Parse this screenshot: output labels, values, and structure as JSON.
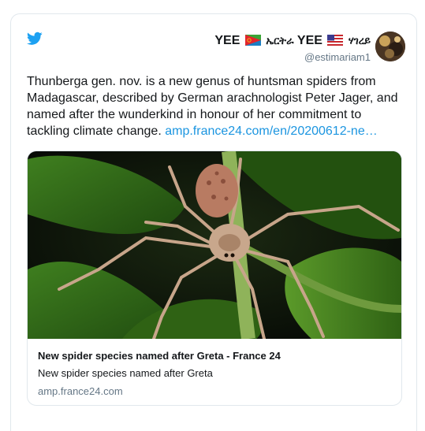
{
  "author": {
    "name_left": "YEE",
    "name_geez_1": "ኤርትራ",
    "name_mid": "YEE",
    "name_geez_2": "ሃገረይ",
    "handle": "@estimariam1",
    "flags": [
      "eritrea-flag",
      "usa-flag"
    ]
  },
  "tweet": {
    "text": "Thunberga gen. nov. is a new genus of huntsman spiders from Madagascar, described by German arachnologist Peter Jager, and named after the wunderkind in honour of her commitment to tackling climate change.",
    "link_text": "amp.france24.com/en/20200612-ne…"
  },
  "card": {
    "image_subject": "huntsman-spider-on-leaves",
    "title": "New spider species named after Greta - France 24",
    "description": "New spider species named after Greta",
    "domain": "amp.france24.com"
  },
  "colors": {
    "twitter_blue": "#1da1f2",
    "link": "#1b95e0",
    "secondary_text": "#657786",
    "border": "#e1e8ed"
  }
}
